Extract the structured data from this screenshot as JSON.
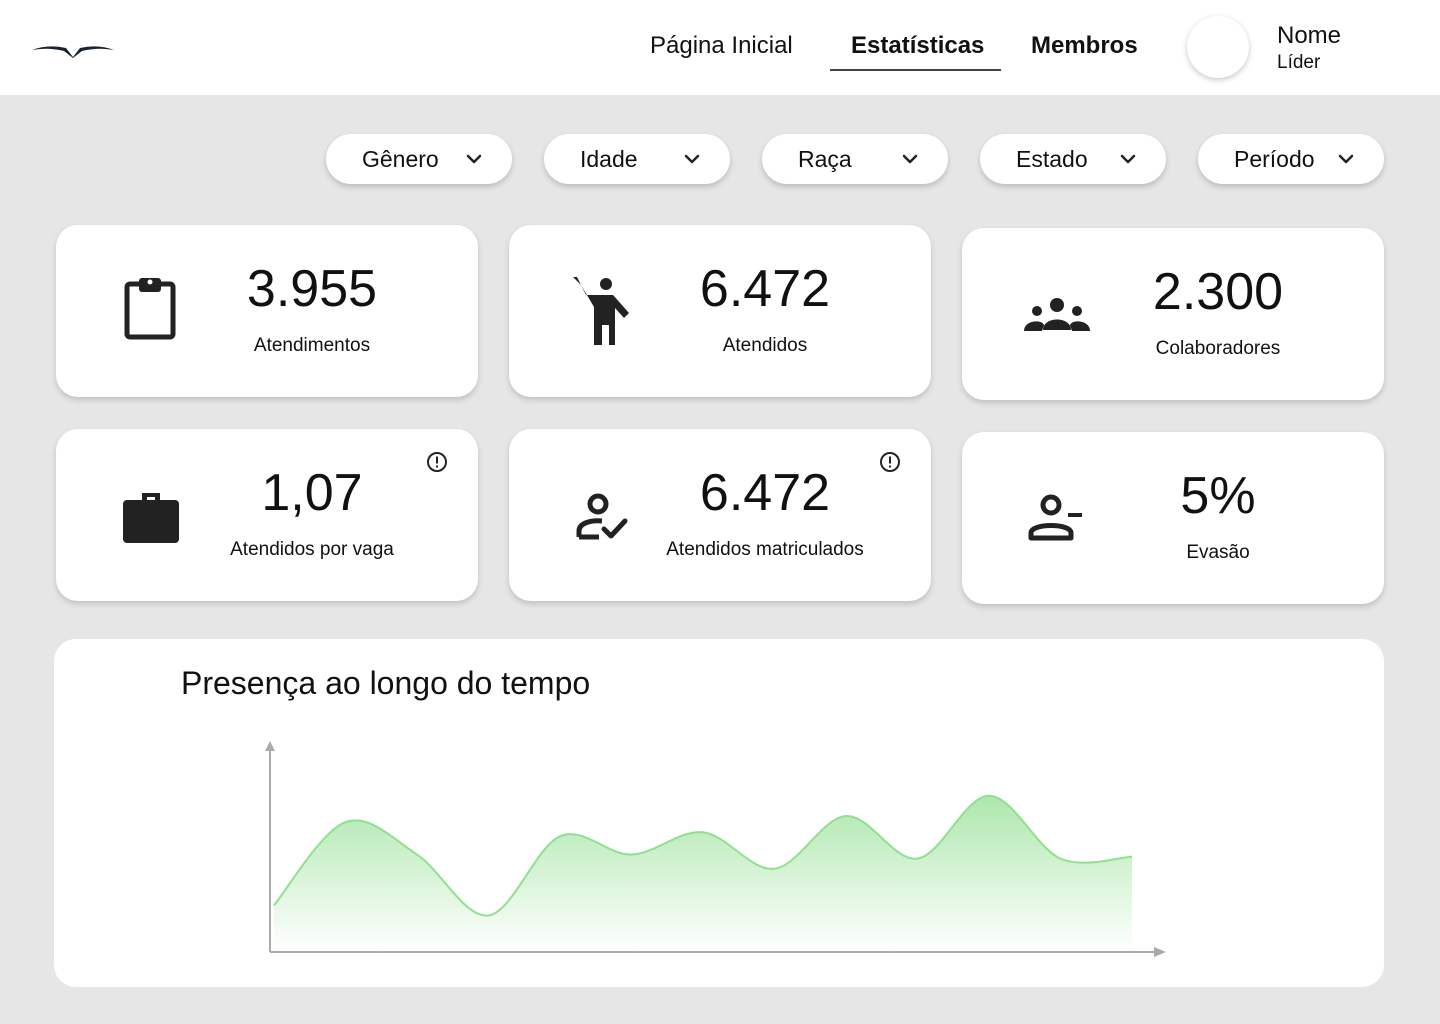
{
  "header": {
    "logo_icon": "bird-logo-icon",
    "nav": [
      {
        "label": "Página Inicial",
        "active": false
      },
      {
        "label": "Estatísticas",
        "active": true
      },
      {
        "label": "Membros",
        "active": false
      }
    ],
    "user": {
      "name": "Nome",
      "role": "Líder"
    }
  },
  "filters": [
    {
      "label": "Gênero",
      "icon": "chevron-down-icon"
    },
    {
      "label": "Idade",
      "icon": "chevron-down-icon"
    },
    {
      "label": "Raça",
      "icon": "chevron-down-icon"
    },
    {
      "label": "Estado",
      "icon": "chevron-down-icon"
    },
    {
      "label": "Período",
      "icon": "chevron-down-icon"
    }
  ],
  "cards": [
    {
      "value": "3.955",
      "label": "Atendimentos",
      "icon": "clipboard-icon",
      "info": false
    },
    {
      "value": "6.472",
      "label": "Atendidos",
      "icon": "person-waving-icon",
      "info": false
    },
    {
      "value": "2.300",
      "label": "Colaboradores",
      "icon": "group-icon",
      "info": false
    },
    {
      "value": "1,07",
      "label": "Atendidos por vaga",
      "icon": "briefcase-icon",
      "info": true
    },
    {
      "value": "6.472",
      "label": "Atendidos matriculados",
      "icon": "person-check-icon",
      "info": true
    },
    {
      "value": "5%",
      "label": "Evasão",
      "icon": "person-remove-icon",
      "info": false
    }
  ],
  "chart": {
    "title": "Presença ao longo do tempo",
    "colors": {
      "line": "#8fe08f",
      "fill_top": "#a8e6a8",
      "fill_bottom": "#ffffff",
      "axis": "#aaaaaa"
    }
  },
  "chart_data": {
    "type": "area",
    "title": "Presença ao longo do tempo",
    "xlabel": "",
    "ylabel": "",
    "grid": false,
    "x": [
      0,
      1,
      2,
      3,
      4,
      5,
      6,
      7,
      8,
      9,
      10,
      11,
      12
    ],
    "values": [
      0.23,
      0.64,
      0.48,
      0.18,
      0.57,
      0.48,
      0.59,
      0.41,
      0.67,
      0.46,
      0.77,
      0.46,
      0.47
    ],
    "ylim": [
      0,
      1
    ]
  }
}
